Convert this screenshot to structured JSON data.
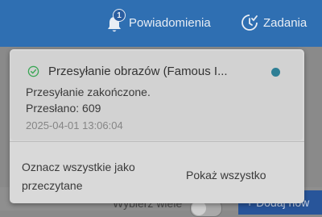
{
  "header": {
    "notifications_label": "Powiadomienia",
    "notifications_count": "1",
    "tasks_label": "Zadania"
  },
  "background": {
    "label": "Wybierz wiele",
    "button_label": "+ Dodaj now"
  },
  "dropdown": {
    "notification": {
      "title": "Przesyłanie obrazów (Famous I...",
      "message": "Przesyłanie zakończone.",
      "detail": "Przesłano: 609",
      "timestamp": "2025-04-01 13:06:04",
      "status_icon": "check-circle-icon",
      "unread_color": "#2e7f95"
    },
    "mark_all_label": "Oznacz wszystkie jako przeczytane",
    "show_all_label": "Pokaż wszystko"
  },
  "colors": {
    "header": "#2f6fb2",
    "accent": "#28559a",
    "success": "#3aa655"
  }
}
